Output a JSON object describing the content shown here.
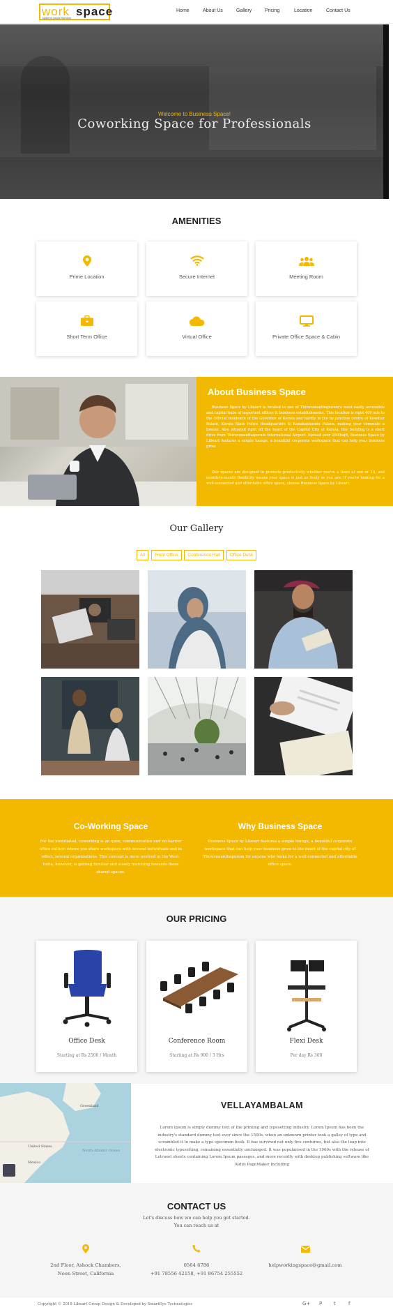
{
  "brand": {
    "logo_left": "work",
    "logo_right": "space",
    "tagline": "space for people that work",
    "accent": "#f3b900"
  },
  "nav": [
    {
      "label": "Home"
    },
    {
      "label": "About Us"
    },
    {
      "label": "Gallery"
    },
    {
      "label": "Pricing"
    },
    {
      "label": "Location"
    },
    {
      "label": "Contact Us"
    }
  ],
  "hero": {
    "welcome": "Welcome to Business Space!",
    "title": "Coworking Space for Professionals"
  },
  "amenities": {
    "title": "AMENITIES",
    "items": [
      {
        "label": "Prime Location",
        "icon": "map-pin-icon"
      },
      {
        "label": "Secure Internet",
        "icon": "wifi-icon"
      },
      {
        "label": "Meeting Room",
        "icon": "users-icon"
      },
      {
        "label": "Short Term Office",
        "icon": "briefcase-icon"
      },
      {
        "label": "Virtual Office",
        "icon": "cloud-icon"
      },
      {
        "label": "Private Office Space & Cabin",
        "icon": "monitor-icon"
      }
    ]
  },
  "about": {
    "title": "About Business Space",
    "p1": "Business Space by Libeart is located in one of Thiruvananthapuram's most easily accessible and capital hubs of important offices & business establishments. This location is right 400 mts to the Official residence of the Governor of Kerala and hardly in the by junction centre of Kowdiar Palace, Kerala State Police Headquarters & Kanakakkunnu Palace, making your commute a breeze. Also situated right off the heart of the Capitol City of Kerala, this building is a short drive from Thiruvananthapuram International Airport. Spread over 2000sqft, Business Space by Libeart features a simple lounge, a beautiful corporate workspace that can help your business grow.",
    "p2": "Our spaces are designed to promote productivity whether you're a team of one or 10, and month-to-month flexibility means your space is just as lively as you are. If you're looking for a well-connected and affordable office space, choose Business Space by Libeart."
  },
  "gallery": {
    "title": "Our Gallery",
    "filters": [
      "All",
      "Front Office",
      "Conference Hall",
      "Office Desk"
    ]
  },
  "coworking": {
    "title": "Co-Working Space",
    "text": "For the uninitiated, coworking is an open, communicative and no barrier office culture where you share workspace with several individuals and in effect, several organizations. This concept is more evolved in the West. India, however, is getting familiar and slowly marching towards these shared spaces."
  },
  "why": {
    "title": "Why Business Space",
    "text": "Business Space by Libeart features a simple lounge, a beautiful corporate workspace that can help your business grow to the heart of the capital city of Thiruvananthapuram for anyone who looks for a well-connected and affordable office space."
  },
  "pricing": {
    "title": "OUR PRICING",
    "items": [
      {
        "name": "Office Desk",
        "price": "Starting at Rs 2500 / Month"
      },
      {
        "name": "Conference Room",
        "price": "Starting at Rs 900 / 3 Hrs"
      },
      {
        "name": "Flexi Desk",
        "price": "Per day Rs 300"
      }
    ]
  },
  "location": {
    "title": "VELLAYAMBALAM",
    "text": "Lorem Ipsum is simply dummy text of the printing and typesetting industry. Lorem Ipsum has been the industry's standard dummy text ever since the 1500s, when an unknown printer took a galley of type and scrambled it to make a type specimen book. It has survived not only five centuries, but also the leap into electronic typesetting, remaining essentially unchanged. It was popularised in the 1960s with the release of Letraset sheets containing Lorem Ipsum passages, and more recently with desktop publishing software like Aldus PageMaker including",
    "map_labels": [
      "Greenland",
      "United States",
      "Mexico",
      "North Atlantic Ocean"
    ]
  },
  "contact": {
    "title": "CONTACT US",
    "sub1": "Let's discuss how we can help you get started.",
    "sub2": "You can reach us at",
    "address1": "2nd Floor, Ashock Chambers,",
    "address2": "Noon Street, California",
    "phone1": "0564 6786",
    "phone2": "+91 78556 42158, +91 86754 255552",
    "email": "helpworkingspace@gmail.com"
  },
  "footer": {
    "copyright": "Copyright © 2018 Libeart Group Design & Developed by SmartEye Technologies",
    "social": [
      "G+",
      "P",
      "t",
      "f"
    ]
  }
}
